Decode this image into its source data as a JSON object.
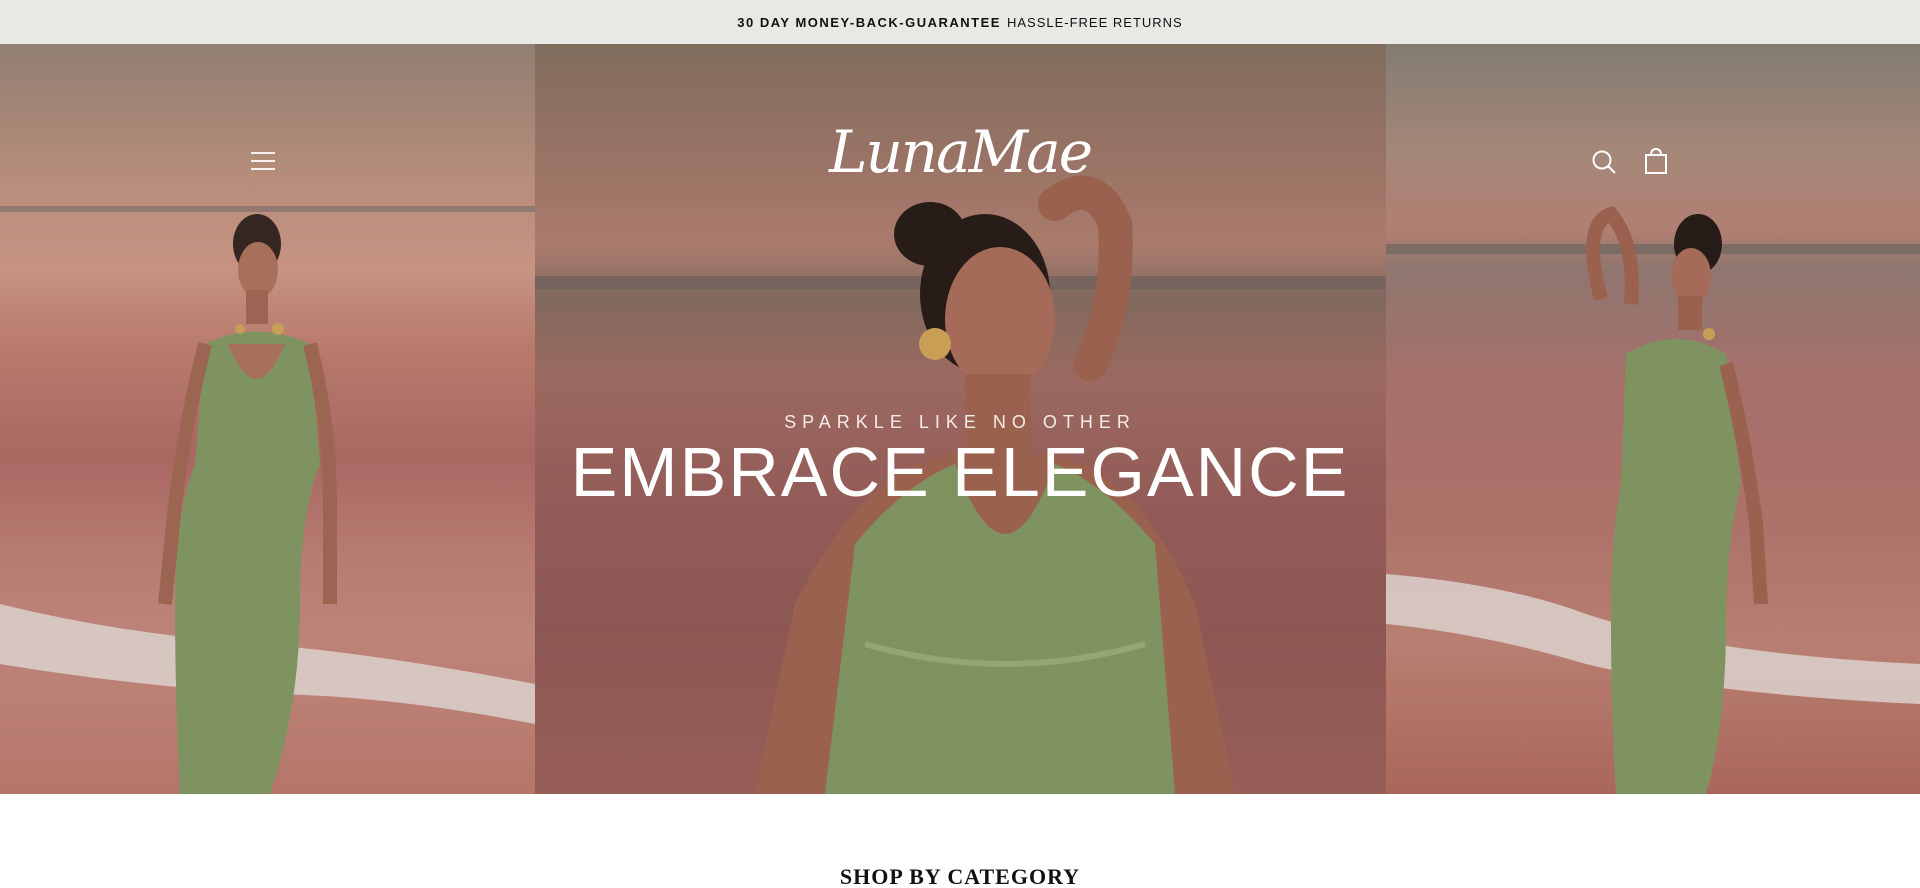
{
  "announcement": {
    "strong": "30 DAY MONEY-BACK-GUARANTEE",
    "rest": "HASSLE-FREE RETURNS"
  },
  "header": {
    "logo_text": "LunaMae",
    "menu_icon": "menu-icon",
    "search_icon": "search-icon",
    "cart_icon": "cart-icon"
  },
  "hero": {
    "kicker": "SPARKLE LIKE NO OTHER",
    "headline": "EMBRACE ELEGANCE"
  },
  "sections": {
    "category_title": "SHOP BY CATEGORY"
  },
  "colors": {
    "announce_bg": "#e8e9e4",
    "dress_green": "#8aa06a",
    "sunset_pink": "#c98676",
    "text_white": "#ffffff"
  }
}
